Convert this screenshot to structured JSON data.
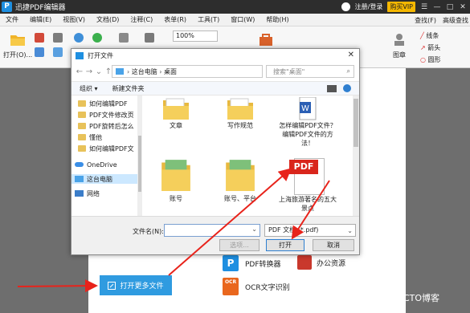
{
  "app": {
    "title": "迅捷PDF编辑器",
    "logo_letter": "P",
    "login": "注册/登录",
    "vip": "购买VIP",
    "window_buttons": [
      "☰",
      "—",
      "□",
      "✕"
    ]
  },
  "menu": {
    "items": [
      "文件",
      "编辑(E)",
      "视图(V)",
      "文档(D)",
      "注释(C)",
      "表单(R)",
      "工具(T)",
      "窗口(W)",
      "帮助(H)"
    ],
    "right": [
      "查找(F)",
      "高级查找"
    ]
  },
  "toolbar": {
    "open": "打开(O)...",
    "zoom": "100%",
    "tools": "工具",
    "stamp": "图章",
    "right_tools": [
      "线条",
      "箭头",
      "圆形"
    ]
  },
  "dialog": {
    "title": "打开文件",
    "close": "✕",
    "breadcrumb": [
      "这台电脑",
      "桌面"
    ],
    "search_placeholder": "搜索\"桌面\"",
    "organize": "组织",
    "new_folder": "新建文件夹",
    "nav_items": [
      "如何编辑PDF",
      "PDF文件修改页",
      "PDF旋转后怎么",
      "懂他",
      "如何编辑PDF文",
      "OneDrive",
      "这台电脑",
      "网络"
    ],
    "files": [
      {
        "name": "文章",
        "type": "folder"
      },
      {
        "name": "写作规范",
        "type": "folder"
      },
      {
        "name": "怎样编辑PDF文件？编辑PDF文件的方法！",
        "type": "word"
      },
      {
        "name": "账号",
        "type": "folder"
      },
      {
        "name": "账号、平台",
        "type": "folder"
      },
      {
        "name": "上海旅游著名的五大景点",
        "type": "pdf"
      }
    ],
    "pdf_label": "PDF",
    "filename_label": "文件名(N):",
    "filename_value": "",
    "filetype": "PDF 文档 (*.pdf)",
    "options_btn": "选项...",
    "open_btn": "打开",
    "cancel_btn": "取消"
  },
  "startpage": {
    "open_more": "打开更多文件",
    "converter": "PDF转换器",
    "office": "办公资源",
    "ocr": "OCR文字识别",
    "ocr_badge": "OCR"
  },
  "watermark": "@51CTO博客",
  "colors": {
    "titlebar": "#2d2d2d",
    "accent_blue": "#2f9be0",
    "annotation_red": "#e8231b",
    "vip_gold": "#f5b700",
    "folder_yellow": "#e8c25a",
    "pdf_red": "#d9261c"
  }
}
